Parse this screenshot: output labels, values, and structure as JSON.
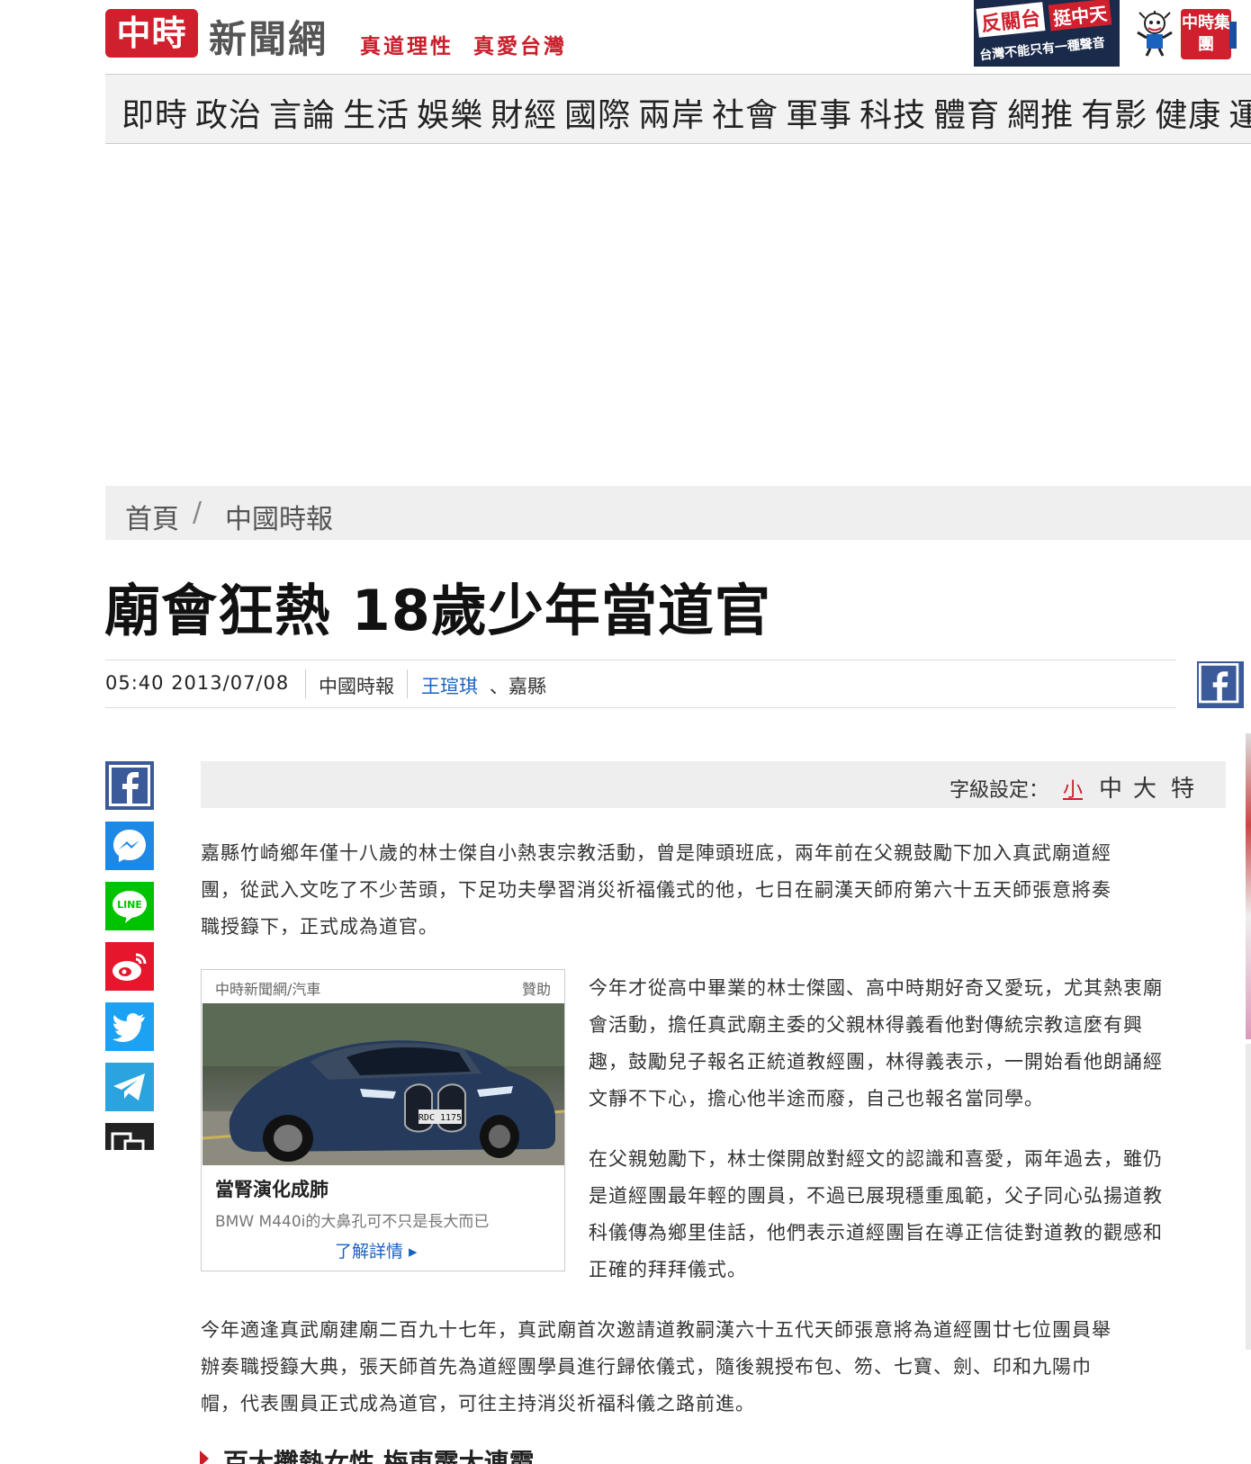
{
  "header": {
    "logo_mark": "中時",
    "logo_text": "新聞網",
    "slogan": "真道理性  真愛台灣",
    "promo": {
      "line1": "反關台",
      "line2": "挺中天",
      "line3": "台灣不能只有一種聲音"
    },
    "group_logo": "中時集團"
  },
  "nav": {
    "items": [
      "即時",
      "政治",
      "言論",
      "生活",
      "娛樂",
      "財經",
      "國際",
      "兩岸",
      "社會",
      "軍事",
      "科技",
      "體育",
      "網推",
      "有影",
      "健康",
      "運勢"
    ]
  },
  "breadcrumb": {
    "home": "首頁",
    "separator": "/",
    "section": "中國時報"
  },
  "article": {
    "title": "廟會狂熱 18歲少年當道官",
    "time": "05:40  2013/07/08",
    "source": "中國時報",
    "author": "王瑄琪",
    "location": "、嘉縣",
    "paragraphs": [
      [
        "嘉縣竹崎鄉年僅十八歲的林士傑自小熱衷宗教活動，曾是陣頭班底，兩年前在父親鼓勵下加入真武廟道經",
        "團，從武入文吃了不少苦頭，下足功夫學習消災祈福儀式的他，七日在嗣漢天師府第六十五天師張意將奏",
        "職授籙下，正式成為道官。"
      ],
      [
        "今年才從高中畢業的林士傑國、高中時期好奇又愛玩，尤其熱衷廟",
        "會活動，擔任真武廟主委的父親林得義看他對傳統宗教這麼有興",
        "趣，鼓勵兒子報名正統道教經團，林得義表示，一開始看他朗誦經",
        "文靜不下心，擔心他半途而廢，自己也報名當同學。"
      ],
      [
        "在父親勉勵下，林士傑開啟對經文的認識和喜愛，兩年過去，雖仍",
        "是道經團最年輕的團員，不過已展現穩重風範，父子同心弘揚道教",
        "科儀傳為鄉里佳話，他們表示道經團旨在導正信徒對道教的觀感和",
        "正確的拜拜儀式。"
      ],
      [
        "今年適逢真武廟建廟二百九十七年，真武廟首次邀請道教嗣漢六十五代天師張意將為道經團廿七位團員舉",
        "辦奏職授籙大典，張天師首先為道經團學員進行歸依儀式，隨後親授布包、笏、七寶、劍、印和九陽巾",
        "帽，代表團員正式成為道官，可往主持消災祈福科儀之路前進。"
      ]
    ],
    "next_link": "百大攤熱女性 梅東霹大連霞"
  },
  "font_size": {
    "label": "字級設定：",
    "options": [
      "小",
      "中",
      "大",
      "特"
    ],
    "selected": "小"
  },
  "ad": {
    "source": "中時新聞網/汽車",
    "sponsored": "贊助",
    "plate": "RDC 1175",
    "headline": "當腎演化成肺",
    "description": "BMW M440i的大鼻孔可不只是長大而已",
    "more": "了解詳情 ▸"
  },
  "share": {
    "icons": [
      "facebook-icon",
      "messenger-icon",
      "line-icon",
      "weibo-icon",
      "twitter-icon",
      "telegram-icon",
      "copy-link-icon"
    ],
    "line_text": "LINE"
  },
  "colors": {
    "brand_red": "#d0202e",
    "link_blue": "#1a62c0",
    "facebook": "#3b5a9a",
    "messenger": "#1e88e5",
    "line": "#00c300",
    "weibo": "#e6162d",
    "twitter": "#1da1f2",
    "telegram": "#2aa3de"
  }
}
